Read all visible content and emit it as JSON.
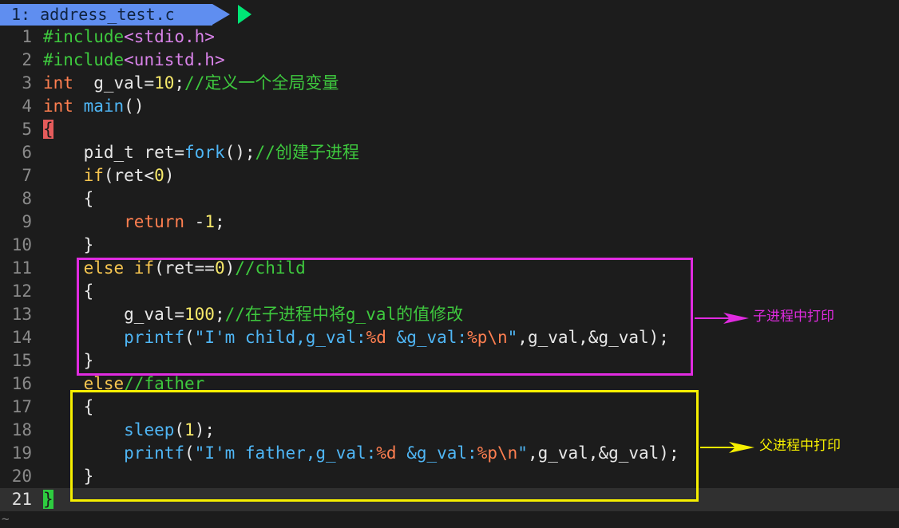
{
  "tabline": {
    "tab_label": "1: address_test.c"
  },
  "lines": [
    {
      "n": "1",
      "parts": [
        [
          "pre",
          "#include"
        ],
        [
          "hdr",
          "<stdio.h>"
        ]
      ]
    },
    {
      "n": "2",
      "parts": [
        [
          "pre",
          "#include"
        ],
        [
          "hdr",
          "<unistd.h>"
        ]
      ]
    },
    {
      "n": "3",
      "parts": [
        [
          "kw",
          "int"
        ],
        [
          "",
          "  g_val="
        ],
        [
          "num",
          "10"
        ],
        [
          "",
          ";"
        ],
        [
          "cm",
          "//定义一个全局变量"
        ]
      ]
    },
    {
      "n": "4",
      "parts": [
        [
          "kw",
          "int"
        ],
        [
          "",
          " "
        ],
        [
          "fn",
          "main"
        ],
        [
          "",
          "()"
        ]
      ]
    },
    {
      "n": "5",
      "parts": [
        [
          "brace-hl",
          "{"
        ]
      ]
    },
    {
      "n": "6",
      "parts": [
        [
          "",
          "    pid_t ret="
        ],
        [
          "fn",
          "fork"
        ],
        [
          "",
          "();"
        ],
        [
          "cm",
          "//创建子进程"
        ]
      ]
    },
    {
      "n": "7",
      "parts": [
        [
          "",
          "    "
        ],
        [
          "kw2",
          "if"
        ],
        [
          "",
          "(ret<"
        ],
        [
          "num",
          "0"
        ],
        [
          "",
          ")"
        ]
      ]
    },
    {
      "n": "8",
      "parts": [
        [
          "",
          "    {"
        ]
      ]
    },
    {
      "n": "9",
      "parts": [
        [
          "",
          "        "
        ],
        [
          "kw",
          "return"
        ],
        [
          "",
          " -"
        ],
        [
          "num",
          "1"
        ],
        [
          "",
          ";"
        ]
      ]
    },
    {
      "n": "10",
      "parts": [
        [
          "",
          "    }"
        ]
      ]
    },
    {
      "n": "11",
      "parts": [
        [
          "",
          "    "
        ],
        [
          "kw2",
          "else if"
        ],
        [
          "",
          "(ret=="
        ],
        [
          "num",
          "0"
        ],
        [
          "",
          ")"
        ],
        [
          "cm",
          "//child"
        ]
      ]
    },
    {
      "n": "12",
      "parts": [
        [
          "",
          "    {"
        ]
      ]
    },
    {
      "n": "13",
      "parts": [
        [
          "",
          "        g_val="
        ],
        [
          "num",
          "100"
        ],
        [
          "",
          ";"
        ],
        [
          "cm",
          "//在子进程中将g_val的值修改"
        ]
      ]
    },
    {
      "n": "14",
      "parts": [
        [
          "",
          "        "
        ],
        [
          "fn",
          "printf"
        ],
        [
          "",
          "("
        ],
        [
          "str",
          "\"I'm child,g_val:"
        ],
        [
          "fmt",
          "%d"
        ],
        [
          "str",
          " &g_val:"
        ],
        [
          "fmt",
          "%p\\n"
        ],
        [
          "str",
          "\""
        ],
        [
          "",
          ",g_val,&g_val);"
        ]
      ]
    },
    {
      "n": "15",
      "parts": [
        [
          "",
          "    }"
        ]
      ]
    },
    {
      "n": "16",
      "parts": [
        [
          "",
          "    "
        ],
        [
          "kw2",
          "else"
        ],
        [
          "cm",
          "//father"
        ]
      ]
    },
    {
      "n": "17",
      "parts": [
        [
          "",
          "    {"
        ]
      ]
    },
    {
      "n": "18",
      "parts": [
        [
          "",
          "        "
        ],
        [
          "fn",
          "sleep"
        ],
        [
          "",
          "("
        ],
        [
          "num",
          "1"
        ],
        [
          "",
          ");"
        ]
      ]
    },
    {
      "n": "19",
      "parts": [
        [
          "",
          "        "
        ],
        [
          "fn",
          "printf"
        ],
        [
          "",
          "("
        ],
        [
          "str",
          "\"I'm father,g_val:"
        ],
        [
          "fmt",
          "%d"
        ],
        [
          "str",
          " &g_val:"
        ],
        [
          "fmt",
          "%p\\n"
        ],
        [
          "str",
          "\""
        ],
        [
          "",
          ",g_val,&g_val);"
        ]
      ]
    },
    {
      "n": "20",
      "parts": [
        [
          "",
          "    }"
        ]
      ]
    },
    {
      "n": "21",
      "parts": [
        [
          "brace-hl2",
          "}"
        ]
      ],
      "current": true
    }
  ],
  "tilde": "~",
  "annotations": {
    "child_note": "子进程中打印",
    "father_note": "父进程中打印",
    "child_color": "#e02be0",
    "father_color": "#f6ef00"
  }
}
